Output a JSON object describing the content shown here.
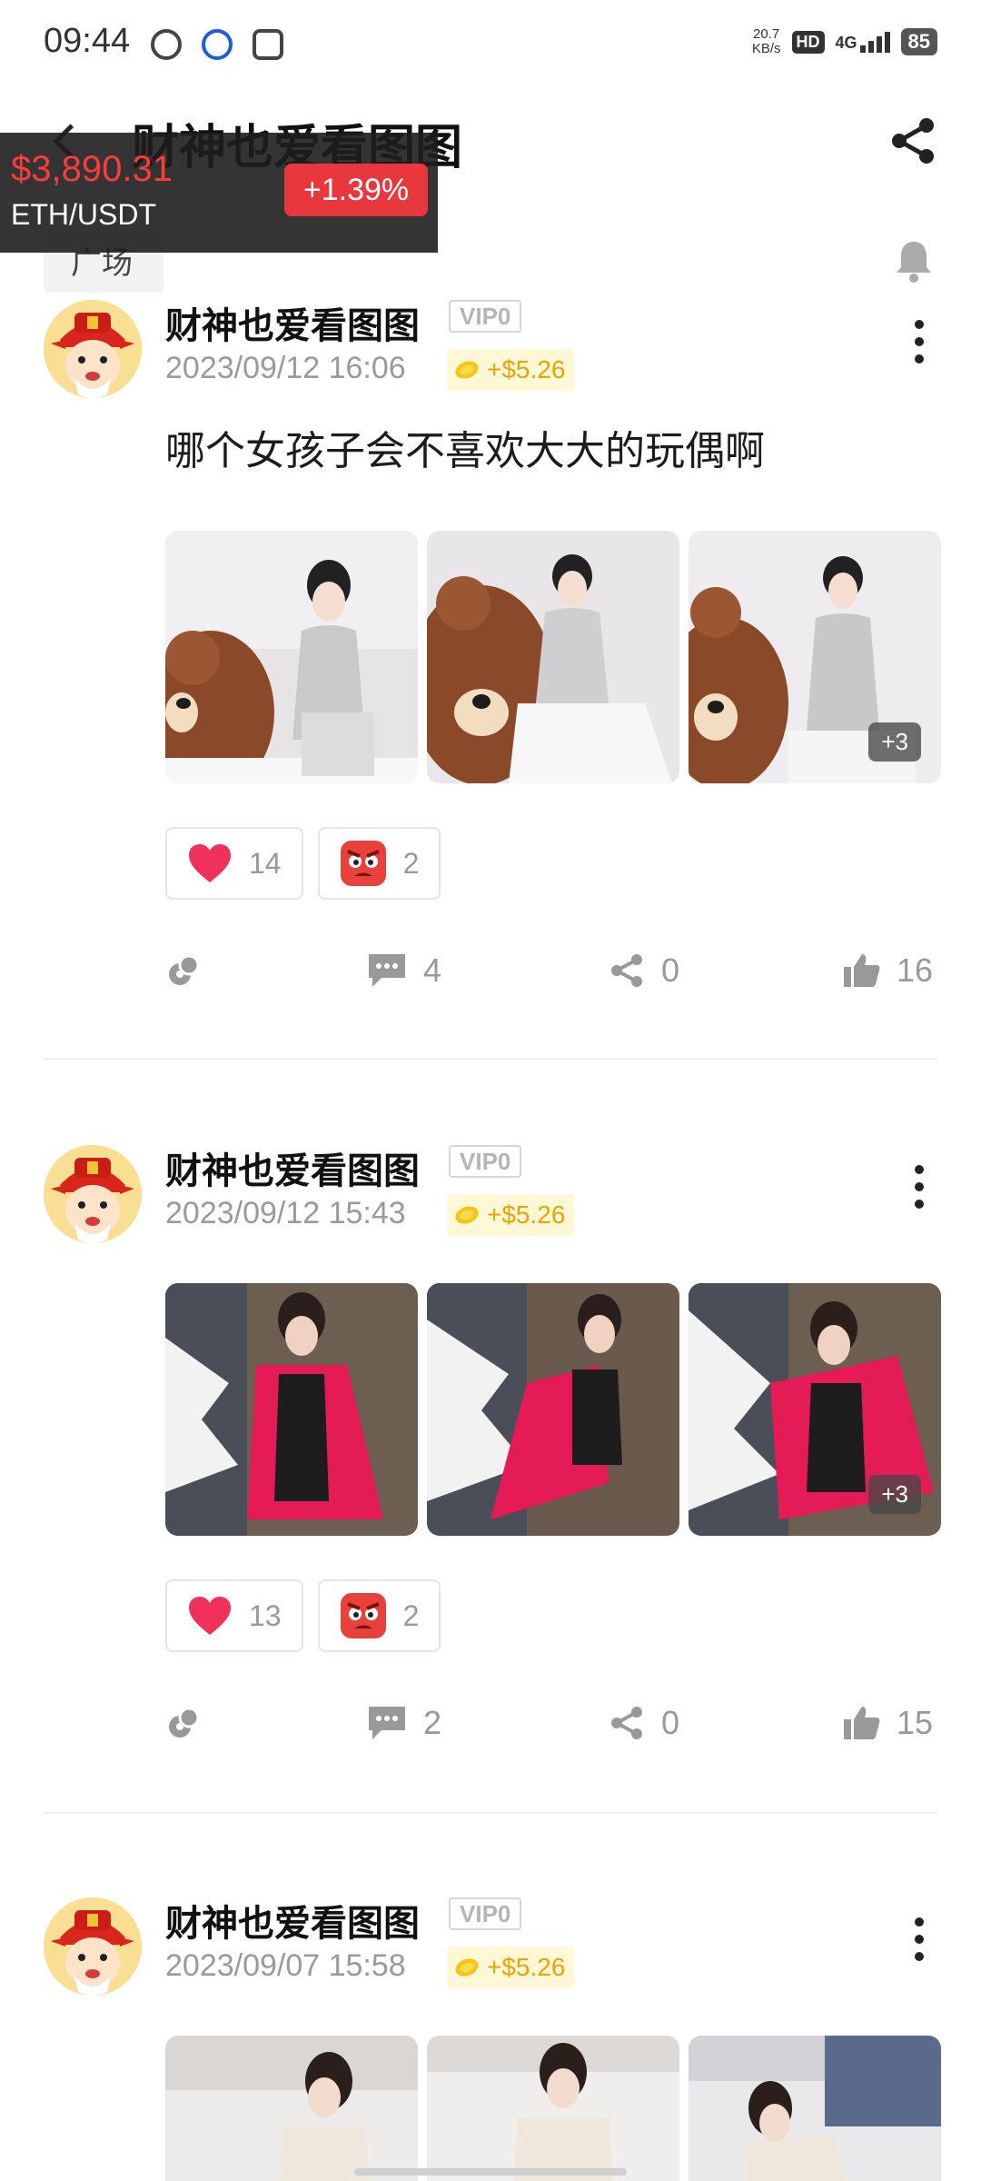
{
  "status_bar": {
    "time": "09:44",
    "net_speed_value": "20.7",
    "net_speed_unit": "KB/s",
    "hd": "HD",
    "network": "4G",
    "battery": "85"
  },
  "header": {
    "title": "财神也爱看图图"
  },
  "ticker": {
    "price": "$3,890.31",
    "pair": "ETH/USDT",
    "change": "+1.39%"
  },
  "tabs": {
    "plaza": "广场"
  },
  "posts": [
    {
      "author": "财神也爱看图图",
      "vip": "VIP0",
      "date": "2023/09/12 16:06",
      "reward": "+$5.26",
      "text": "哪个女孩子会不喜欢大大的玩偶啊",
      "more_images": "+3",
      "heart_count": "14",
      "angry_count": "2",
      "comments": "4",
      "shares": "0",
      "likes": "16"
    },
    {
      "author": "财神也爱看图图",
      "vip": "VIP0",
      "date": "2023/09/12 15:43",
      "reward": "+$5.26",
      "text": "",
      "more_images": "+3",
      "heart_count": "13",
      "angry_count": "2",
      "comments": "2",
      "shares": "0",
      "likes": "15"
    },
    {
      "author": "财神也爱看图图",
      "vip": "VIP0",
      "date": "2023/09/07 15:58",
      "reward": "+$5.26"
    }
  ],
  "colors": {
    "ticker_price": "#ff3b3b",
    "ticker_change_bg": "#e8383d",
    "reward_text": "#e8a400",
    "reward_bg": "#fff8d6",
    "muted_text": "#9a9a9a"
  },
  "icons": {
    "back": "chevron-left-icon",
    "share": "share-icon",
    "bell": "bell-icon",
    "more": "more-vertical-icon",
    "coin": "coin-icon",
    "heart": "heart-icon",
    "angry": "angry-face-icon",
    "tip": "coin-tip-icon",
    "comment": "comment-icon",
    "like": "thumbs-up-icon"
  }
}
